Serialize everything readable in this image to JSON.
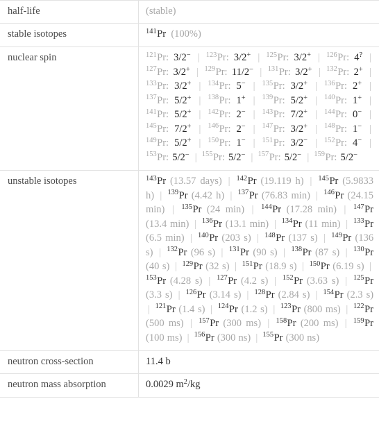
{
  "table": {
    "rows": [
      {
        "label": "half-life",
        "type": "simple",
        "value": "(stable)",
        "muted": true
      },
      {
        "label": "stable isotopes",
        "type": "stable",
        "value": ""
      },
      {
        "label": "nuclear spin",
        "type": "spin",
        "value": ""
      },
      {
        "label": "unstable isotopes",
        "type": "unstable",
        "value": ""
      },
      {
        "label": "neutron cross-section",
        "type": "simple",
        "value": "11.4 b",
        "muted": false
      },
      {
        "label": "neutron mass absorption",
        "type": "mass-absorption",
        "value": "0.0029 m2/kg",
        "muted": false
      }
    ]
  },
  "half_life": {
    "label": "half-life",
    "value": "(stable)"
  },
  "stable_isotopes": {
    "label": "stable isotopes",
    "items": [
      {
        "mass": "141",
        "symbol": "Pr",
        "value": "(100%)"
      }
    ]
  },
  "nuclear_spin": {
    "label": "nuclear spin",
    "element": "Pr",
    "separator": "|",
    "items": [
      {
        "mass": "121",
        "symbol": "Pr",
        "spin": "3/2",
        "parity": "−"
      },
      {
        "mass": "123",
        "symbol": "Pr",
        "spin": "3/2",
        "parity": "+"
      },
      {
        "mass": "125",
        "symbol": "Pr",
        "spin": "3/2",
        "parity": "+"
      },
      {
        "mass": "126",
        "symbol": "Pr",
        "spin": "4",
        "parity": "?"
      },
      {
        "mass": "127",
        "symbol": "Pr",
        "spin": "3/2",
        "parity": "+"
      },
      {
        "mass": "129",
        "symbol": "Pr",
        "spin": "11/2",
        "parity": "−"
      },
      {
        "mass": "131",
        "symbol": "Pr",
        "spin": "3/2",
        "parity": "+"
      },
      {
        "mass": "132",
        "symbol": "Pr",
        "spin": "2",
        "parity": "+"
      },
      {
        "mass": "133",
        "symbol": "Pr",
        "spin": "3/2",
        "parity": "+"
      },
      {
        "mass": "134",
        "symbol": "Pr",
        "spin": "5",
        "parity": "−"
      },
      {
        "mass": "135",
        "symbol": "Pr",
        "spin": "3/2",
        "parity": "+"
      },
      {
        "mass": "136",
        "symbol": "Pr",
        "spin": "2",
        "parity": "+"
      },
      {
        "mass": "137",
        "symbol": "Pr",
        "spin": "5/2",
        "parity": "+"
      },
      {
        "mass": "138",
        "symbol": "Pr",
        "spin": "1",
        "parity": "+"
      },
      {
        "mass": "139",
        "symbol": "Pr",
        "spin": "5/2",
        "parity": "+"
      },
      {
        "mass": "140",
        "symbol": "Pr",
        "spin": "1",
        "parity": "+"
      },
      {
        "mass": "141",
        "symbol": "Pr",
        "spin": "5/2",
        "parity": "+"
      },
      {
        "mass": "142",
        "symbol": "Pr",
        "spin": "2",
        "parity": "−"
      },
      {
        "mass": "143",
        "symbol": "Pr",
        "spin": "7/2",
        "parity": "+"
      },
      {
        "mass": "144",
        "symbol": "Pr",
        "spin": "0",
        "parity": "−"
      },
      {
        "mass": "145",
        "symbol": "Pr",
        "spin": "7/2",
        "parity": "+"
      },
      {
        "mass": "146",
        "symbol": "Pr",
        "spin": "2",
        "parity": "−"
      },
      {
        "mass": "147",
        "symbol": "Pr",
        "spin": "3/2",
        "parity": "+"
      },
      {
        "mass": "148",
        "symbol": "Pr",
        "spin": "1",
        "parity": "−"
      },
      {
        "mass": "149",
        "symbol": "Pr",
        "spin": "5/2",
        "parity": "+"
      },
      {
        "mass": "150",
        "symbol": "Pr",
        "spin": "1",
        "parity": "−"
      },
      {
        "mass": "151",
        "symbol": "Pr",
        "spin": "3/2",
        "parity": "−"
      },
      {
        "mass": "152",
        "symbol": "Pr",
        "spin": "4",
        "parity": "−"
      },
      {
        "mass": "153",
        "symbol": "Pr",
        "spin": "5/2",
        "parity": "−"
      },
      {
        "mass": "155",
        "symbol": "Pr",
        "spin": "5/2",
        "parity": "−"
      },
      {
        "mass": "157",
        "symbol": "Pr",
        "spin": "5/2",
        "parity": "−"
      },
      {
        "mass": "159",
        "symbol": "Pr",
        "spin": "5/2",
        "parity": "−"
      }
    ]
  },
  "unstable_isotopes": {
    "label": "unstable isotopes",
    "element": "Pr",
    "separator": "|",
    "items": [
      {
        "mass": "143",
        "symbol": "Pr",
        "half_life": "(13.57 days)"
      },
      {
        "mass": "142",
        "symbol": "Pr",
        "half_life": "(19.119 h)"
      },
      {
        "mass": "145",
        "symbol": "Pr",
        "half_life": "(5.9833 h)"
      },
      {
        "mass": "139",
        "symbol": "Pr",
        "half_life": "(4.42 h)"
      },
      {
        "mass": "137",
        "symbol": "Pr",
        "half_life": "(76.83 min)"
      },
      {
        "mass": "146",
        "symbol": "Pr",
        "half_life": "(24.15 min)"
      },
      {
        "mass": "135",
        "symbol": "Pr",
        "half_life": "(24 min)"
      },
      {
        "mass": "144",
        "symbol": "Pr",
        "half_life": "(17.28 min)"
      },
      {
        "mass": "147",
        "symbol": "Pr",
        "half_life": "(13.4 min)"
      },
      {
        "mass": "136",
        "symbol": "Pr",
        "half_life": "(13.1 min)"
      },
      {
        "mass": "134",
        "symbol": "Pr",
        "half_life": "(11 min)"
      },
      {
        "mass": "133",
        "symbol": "Pr",
        "half_life": "(6.5 min)"
      },
      {
        "mass": "140",
        "symbol": "Pr",
        "half_life": "(203 s)"
      },
      {
        "mass": "148",
        "symbol": "Pr",
        "half_life": "(137 s)"
      },
      {
        "mass": "149",
        "symbol": "Pr",
        "half_life": "(136 s)"
      },
      {
        "mass": "132",
        "symbol": "Pr",
        "half_life": "(96 s)"
      },
      {
        "mass": "131",
        "symbol": "Pr",
        "half_life": "(90 s)"
      },
      {
        "mass": "138",
        "symbol": "Pr",
        "half_life": "(87 s)"
      },
      {
        "mass": "130",
        "symbol": "Pr",
        "half_life": "(40 s)"
      },
      {
        "mass": "129",
        "symbol": "Pr",
        "half_life": "(32 s)"
      },
      {
        "mass": "151",
        "symbol": "Pr",
        "half_life": "(18.9 s)"
      },
      {
        "mass": "150",
        "symbol": "Pr",
        "half_life": "(6.19 s)"
      },
      {
        "mass": "153",
        "symbol": "Pr",
        "half_life": "(4.28 s)"
      },
      {
        "mass": "127",
        "symbol": "Pr",
        "half_life": "(4.2 s)"
      },
      {
        "mass": "152",
        "symbol": "Pr",
        "half_life": "(3.63 s)"
      },
      {
        "mass": "125",
        "symbol": "Pr",
        "half_life": "(3.3 s)"
      },
      {
        "mass": "126",
        "symbol": "Pr",
        "half_life": "(3.14 s)"
      },
      {
        "mass": "128",
        "symbol": "Pr",
        "half_life": "(2.84 s)"
      },
      {
        "mass": "154",
        "symbol": "Pr",
        "half_life": "(2.3 s)"
      },
      {
        "mass": "121",
        "symbol": "Pr",
        "half_life": "(1.4 s)"
      },
      {
        "mass": "124",
        "symbol": "Pr",
        "half_life": "(1.2 s)"
      },
      {
        "mass": "123",
        "symbol": "Pr",
        "half_life": "(800 ms)"
      },
      {
        "mass": "122",
        "symbol": "Pr",
        "half_life": "(500 ms)"
      },
      {
        "mass": "157",
        "symbol": "Pr",
        "half_life": "(300 ms)"
      },
      {
        "mass": "158",
        "symbol": "Pr",
        "half_life": "(200 ms)"
      },
      {
        "mass": "159",
        "symbol": "Pr",
        "half_life": "(100 ms)"
      },
      {
        "mass": "156",
        "symbol": "Pr",
        "half_life": "(300 ns)"
      },
      {
        "mass": "155",
        "symbol": "Pr",
        "half_life": "(300 ns)"
      }
    ]
  },
  "neutron_cross_section": {
    "label": "neutron cross-section",
    "value": "11.4 b"
  },
  "neutron_mass_absorption": {
    "label": "neutron mass absorption",
    "value_number": "0.0029",
    "value_unit_base": "m",
    "value_unit_exp": "2",
    "value_unit_suffix": "/kg"
  },
  "colors": {
    "border": "#e2e2e2",
    "label_text": "#4c4c4c",
    "primary_text": "#333333",
    "muted_text": "#a8a8a8",
    "separator": "#c4c4c4"
  }
}
